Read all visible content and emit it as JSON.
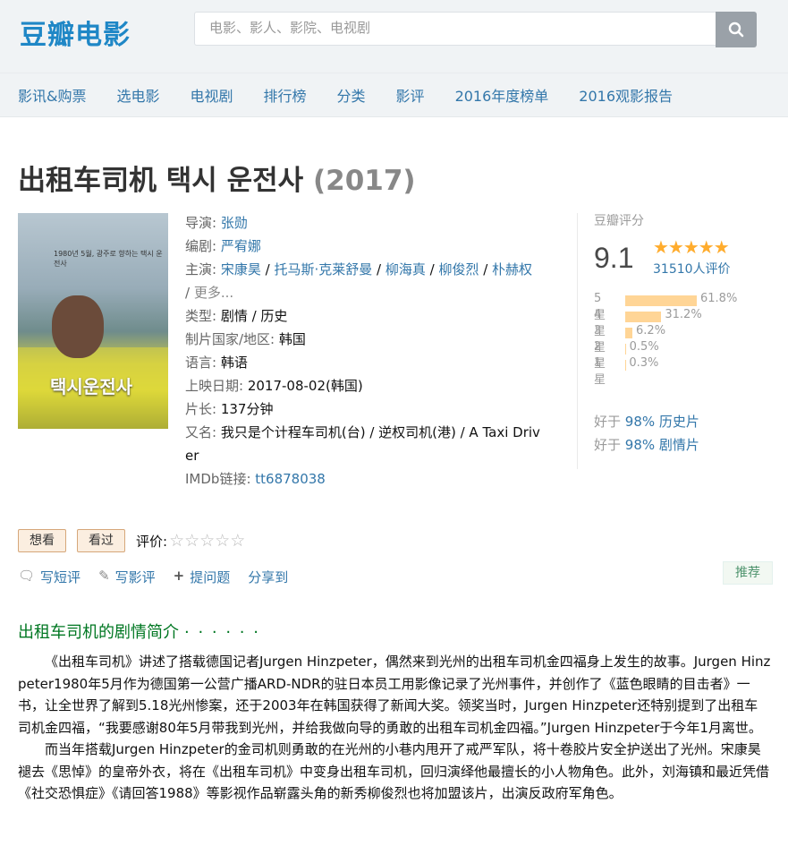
{
  "header": {
    "logo": "豆瓣电影",
    "search_placeholder": "电影、影人、影院、电视剧",
    "search_icon": "search-icon"
  },
  "nav": [
    "影讯&购票",
    "选电影",
    "电视剧",
    "排行榜",
    "分类",
    "影评",
    "2016年度榜单",
    "2016观影报告"
  ],
  "movie": {
    "title": "出租车司机 택시 운전사",
    "year": "(2017)",
    "poster_text_top": "1980년 5월, 광주로 향하는 택시 운전사",
    "poster_title": "택시운전사",
    "director_label": "导演",
    "director": "张勋",
    "writer_label": "编剧",
    "writer": "严宥娜",
    "cast_label": "主演",
    "cast": [
      "宋康昊",
      "托马斯·克莱舒曼",
      "柳海真",
      "柳俊烈",
      "朴赫权"
    ],
    "more": "更多...",
    "genre_label": "类型:",
    "genres": "剧情 / 历史",
    "country_label": "制片国家/地区:",
    "country": "韩国",
    "language_label": "语言:",
    "language": "韩语",
    "release_label": "上映日期:",
    "release": "2017-08-02(韩国)",
    "runtime_label": "片长:",
    "runtime": "137分钟",
    "aka_label": "又名:",
    "aka_line1": "我只是个计程车司机(台) / 逆权司机(港) / A Taxi Driv",
    "aka_line2": "er",
    "imdb_label": "IMDb链接:",
    "imdb": "tt6878038"
  },
  "rating": {
    "label": "豆瓣评分",
    "score": "9.1",
    "stars": "★★★★★",
    "votes": "31510人评价",
    "distribution": [
      {
        "star": "5星",
        "percent": "61.8%",
        "value": 61.8
      },
      {
        "star": "4星",
        "percent": "31.2%",
        "value": 31.2
      },
      {
        "star": "3星",
        "percent": "6.2%",
        "value": 6.2
      },
      {
        "star": "2星",
        "percent": "0.5%",
        "value": 0.5
      },
      {
        "star": "1星",
        "percent": "0.3%",
        "value": 0.3
      }
    ],
    "better_than": [
      {
        "prefix": "好于",
        "link": "98% 历史片"
      },
      {
        "prefix": "好于",
        "link": "98% 剧情片"
      }
    ]
  },
  "actions": {
    "want": "想看",
    "seen": "看过",
    "rate_label": "评价:",
    "rate_stars": "☆☆☆☆☆",
    "short_review": "写短评",
    "review": "写影评",
    "question": "提问题",
    "share": "分享到",
    "recommend": "推荐"
  },
  "summary": {
    "title": "出租车司机的剧情简介",
    "dots": "· · · · · ·",
    "p1": "《出租车司机》讲述了搭载德国记者Jurgen Hinzpeter，偶然来到光州的出租车司机金四福身上发生的故事。Jurgen Hinzpeter1980年5月作为德国第一公营广播ARD-NDR的驻日本员工用影像记录了光州事件，并创作了《蓝色眼睛的目击者》一书，让全世界了解到5.18光州惨案，还于2003年在韩国获得了新闻大奖。领奖当时，Jurgen Hinzpeter还特别提到了出租车司机金四福，“我要感谢80年5月带我到光州，并给我做向导的勇敢的出租车司机金四福。”Jurgen Hinzpeter于今年1月离世。",
    "p2": "而当年搭载Jurgen Hinzpeter的金司机则勇敢的在光州的小巷内甩开了戒严军队，将十卷胶片安全护送出了光州。宋康昊褪去《思悼》的皇帝外衣，将在《出租车司机》中变身出租车司机，回归演绎他最擅长的小人物角色。此外，刘海镇和最近凭借《社交恐惧症》《请回答1988》等影视作品崭露头角的新秀柳俊烈也将加盟该片，出演反政府军角色。"
  }
}
